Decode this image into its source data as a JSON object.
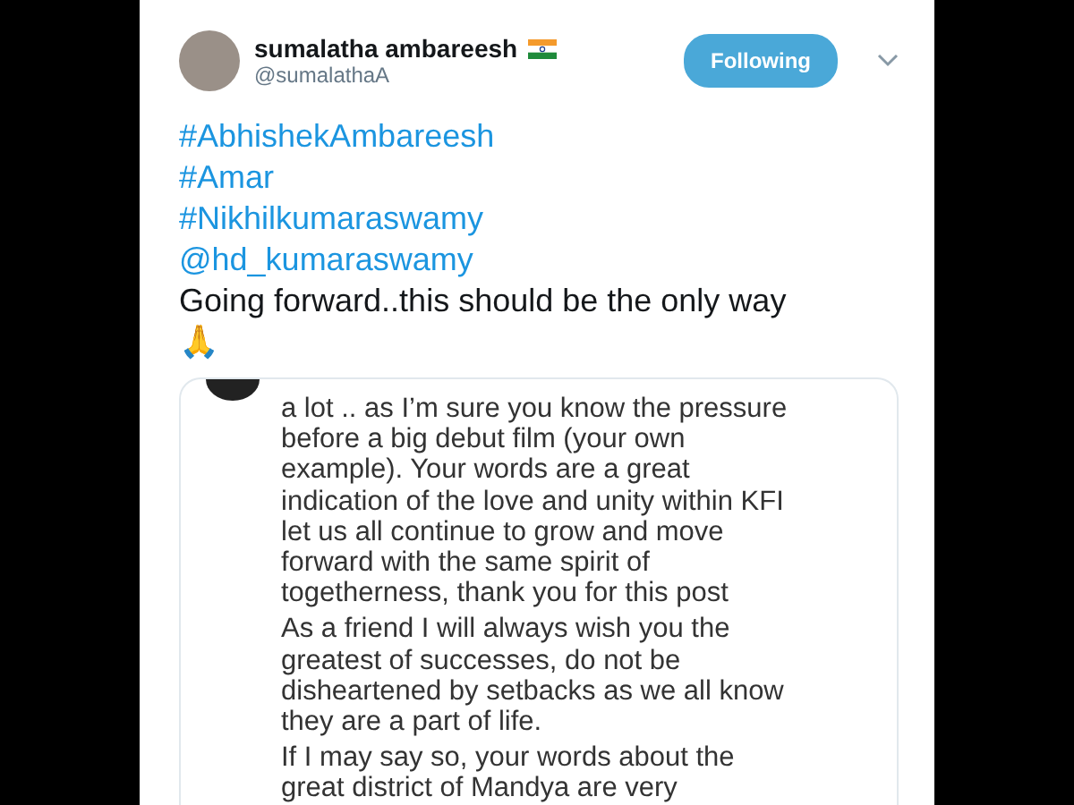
{
  "tweet": {
    "author": {
      "name": "sumalatha ambareesh",
      "handle": "@sumalathaA"
    },
    "follow_button": {
      "label": "Following",
      "selected": true
    },
    "lines": [
      {
        "kind": "hashtag",
        "text": "#AbhishekAmbareesh"
      },
      {
        "kind": "hashtag",
        "text": "#Amar"
      },
      {
        "kind": "hashtag",
        "text": "#Nikhilkumaraswamy"
      },
      {
        "kind": "mention",
        "text": "@hd_kumaraswamy"
      },
      {
        "kind": "plain",
        "text": "Going forward..this should be the only way"
      },
      {
        "kind": "plain",
        "text": "🙏"
      }
    ],
    "attached_screenshot": {
      "paragraphs": [
        [
          "a lot .. as I’m sure you know the pressure",
          "before a big debut film (your own",
          "example). Your words are a great",
          "indication of the love and unity within KFI",
          "let us all continue to grow and move",
          "forward with the same spirit of",
          "togetherness, thank you for this post"
        ],
        [
          "As a friend I will always wish you the",
          "greatest of successes, do not be",
          "disheartened by setbacks as we all know",
          "they are a part of life."
        ],
        [
          "If I may say so, your words about the",
          "great district of Mandya are very"
        ]
      ]
    }
  }
}
